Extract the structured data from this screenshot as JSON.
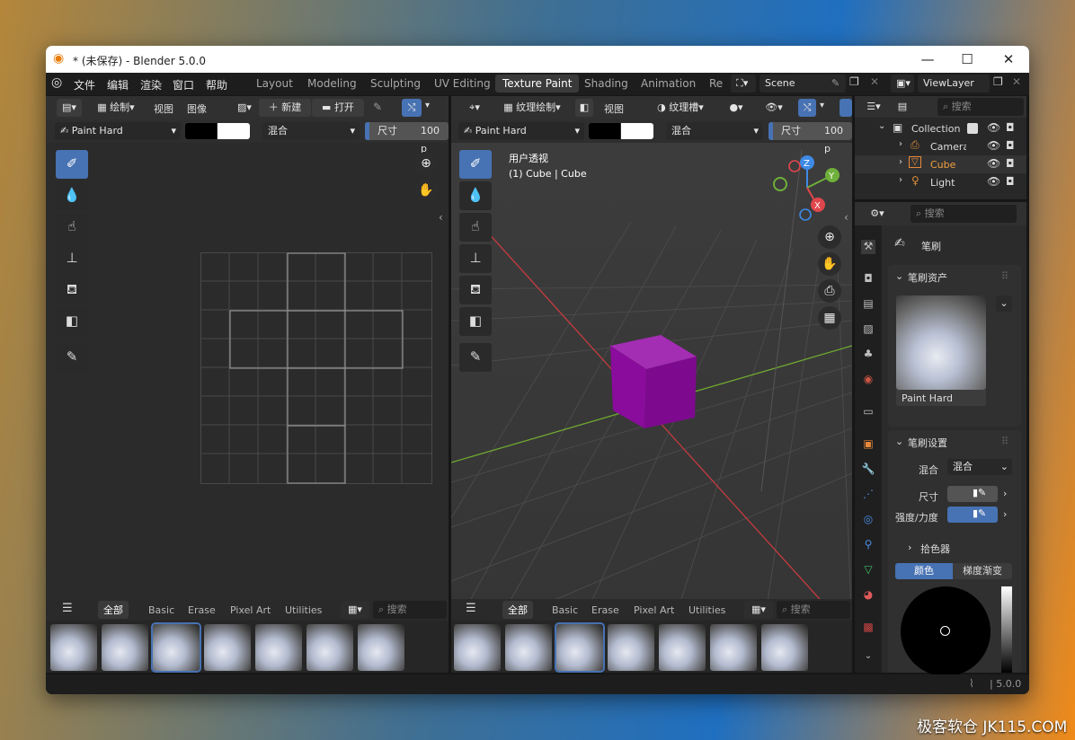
{
  "window": {
    "title": "* (未保存) - Blender 5.0.0",
    "minimize": "—",
    "maximize": "☐",
    "close": "✕"
  },
  "menu": [
    "文件",
    "编辑",
    "渲染",
    "窗口",
    "帮助"
  ],
  "workspaces": [
    "Layout",
    "Modeling",
    "Sculpting",
    "UV Editing",
    "Texture Paint",
    "Shading",
    "Animation",
    "Re"
  ],
  "scene": "Scene",
  "viewlayer": "ViewLayer",
  "image_editor": {
    "header": {
      "draw": "绘制",
      "view": "视图",
      "image": "图像",
      "new": "新建",
      "open": "打开"
    },
    "brush": "Paint Hard",
    "blend": "混合",
    "size_label": "尺寸",
    "size_value": "100 p"
  },
  "viewport": {
    "header": {
      "mode": "纹理绘制",
      "view": "视图",
      "slots": "纹理槽"
    },
    "brush": "Paint Hard",
    "blend": "混合",
    "size_label": "尺寸",
    "size_value": "100 p",
    "overlay_title": "用户透视",
    "overlay_sub": "(1) Cube | Cube",
    "cube_color": "#8a0c9c"
  },
  "asset_shelf": {
    "tabs": [
      "全部",
      "Basic",
      "Erase",
      "Pixel Art",
      "Utilities"
    ],
    "search": "搜索"
  },
  "outliner": {
    "search": "搜索",
    "items": [
      {
        "name": "Collection"
      },
      {
        "name": "Camera"
      },
      {
        "name": "Cube"
      },
      {
        "name": "Light"
      }
    ]
  },
  "properties": {
    "search": "搜索",
    "title": "笔刷",
    "asset_panel": "笔刷资产",
    "asset_name": "Paint Hard",
    "settings_panel": "笔刷设置",
    "blend_label": "混合",
    "blend_value": "混合",
    "size_label": "尺寸",
    "strength_label": "强度/力度",
    "picker_panel": "拾色器",
    "color_tab": "颜色",
    "gradient_tab": "梯度渐变"
  },
  "status": {
    "version": "5.0.0"
  },
  "watermark": "极客软仓 JK115.COM",
  "colors": {
    "accent": "#4772b3",
    "cube": "#8a0c9c",
    "x_axis": "#e0464d",
    "y_axis": "#6fb03a",
    "z_axis": "#3e8ae6"
  }
}
